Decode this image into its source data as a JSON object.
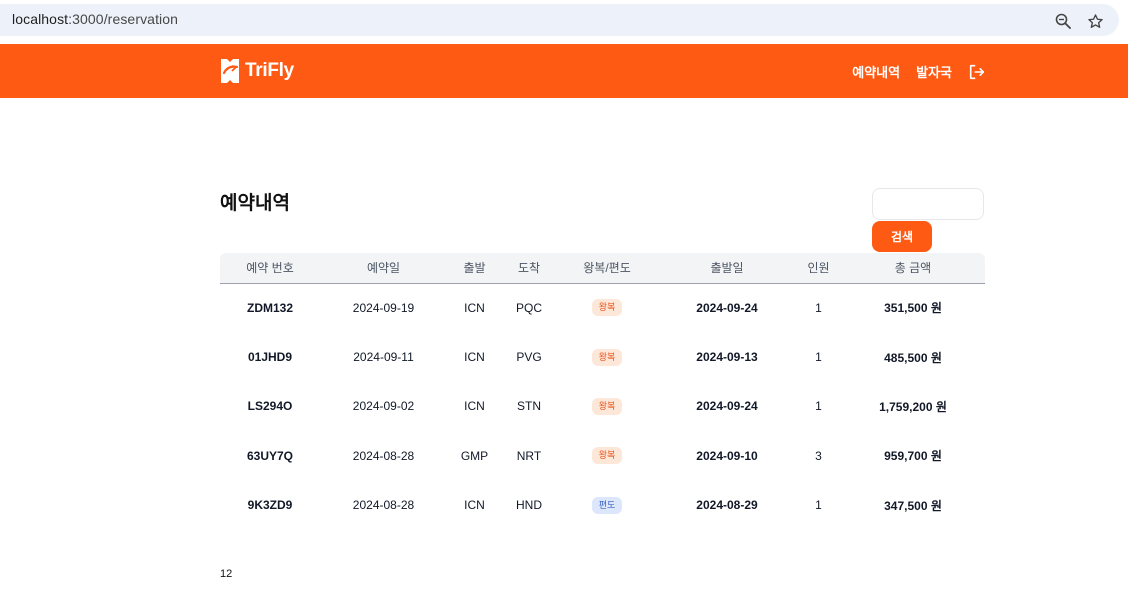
{
  "browser": {
    "url_host": "localhost",
    "url_rest": ":3000/reservation"
  },
  "header": {
    "brand": "TriFly",
    "nav": {
      "reservations": "예약내역",
      "issuer": "발자국"
    },
    "brand_color": "#ff5a14"
  },
  "page": {
    "title": "예약내역",
    "search": {
      "value": "",
      "placeholder": "",
      "button_label": "검색"
    }
  },
  "table": {
    "columns": [
      "예약 번호",
      "예약일",
      "출발",
      "도착",
      "왕복/편도",
      "출발일",
      "인원",
      "총 금액"
    ],
    "rows": [
      {
        "id": "ZDM132",
        "booked": "2024-09-19",
        "from": "ICN",
        "to": "PQC",
        "trip": "왕복",
        "trip_type": "roundtrip",
        "departure": "2024-09-24",
        "people": "1",
        "total": "351,500 원"
      },
      {
        "id": "01JHD9",
        "booked": "2024-09-11",
        "from": "ICN",
        "to": "PVG",
        "trip": "왕복",
        "trip_type": "roundtrip",
        "departure": "2024-09-13",
        "people": "1",
        "total": "485,500 원"
      },
      {
        "id": "LS294O",
        "booked": "2024-09-02",
        "from": "ICN",
        "to": "STN",
        "trip": "왕복",
        "trip_type": "roundtrip",
        "departure": "2024-09-24",
        "people": "1",
        "total": "1,759,200 원"
      },
      {
        "id": "63UY7Q",
        "booked": "2024-08-28",
        "from": "GMP",
        "to": "NRT",
        "trip": "왕복",
        "trip_type": "roundtrip",
        "departure": "2024-09-10",
        "people": "3",
        "total": "959,700 원"
      },
      {
        "id": "9K3ZD9",
        "booked": "2024-08-28",
        "from": "ICN",
        "to": "HND",
        "trip": "편도",
        "trip_type": "oneway",
        "departure": "2024-08-29",
        "people": "1",
        "total": "347,500 원"
      }
    ]
  },
  "pagination": {
    "pages": "12"
  }
}
